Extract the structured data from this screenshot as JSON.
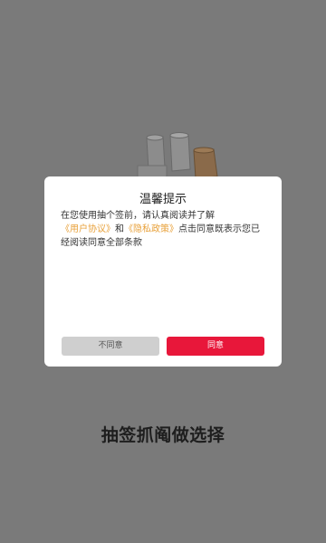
{
  "colors": {
    "background": "#7a7a7a",
    "dialog_bg": "#ffffff",
    "link": "#e8a13a",
    "agree_button": "#e8173a",
    "disagree_button": "#cfcfcf"
  },
  "app": {
    "title": "抽签抓阄做选择"
  },
  "dialog": {
    "title": "温馨提示",
    "body_prefix": "在您使用抽个签前，请认真阅读并了解",
    "user_agreement_link": "《用户协议》",
    "body_and": "和",
    "privacy_policy_link": "《隐私政策》",
    "body_suffix": "点击同意既表示您已经阅读同意全部条款",
    "disagree_label": "不同意",
    "agree_label": "同意"
  },
  "icons": {
    "illustration": "boxes-illustration-icon"
  }
}
